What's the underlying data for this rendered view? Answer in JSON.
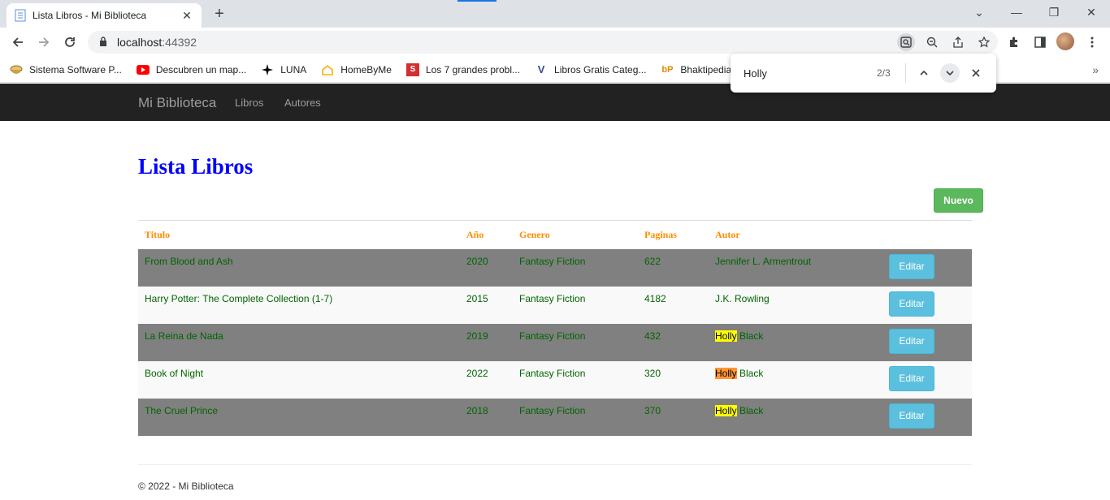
{
  "browser": {
    "tab_title": "Lista Libros - Mi Biblioteca",
    "url_host": "localhost",
    "url_port": ":44392",
    "bookmarks": [
      {
        "label": "Sistema Software P...",
        "icon": "bowl-icon"
      },
      {
        "label": "Descubren un map...",
        "icon": "youtube-icon"
      },
      {
        "label": "LUNA",
        "icon": "sparkle-icon"
      },
      {
        "label": "HomeByMe",
        "icon": "home-icon"
      },
      {
        "label": "Los 7 grandes probl...",
        "icon": "s-icon"
      },
      {
        "label": "Libros Gratis Categ...",
        "icon": "v-icon"
      },
      {
        "label": "Bhaktipedia - Es",
        "icon": "bp-icon"
      }
    ],
    "find": {
      "query": "Holly",
      "count": "2/3"
    }
  },
  "navbar": {
    "brand": "Mi Biblioteca",
    "links": [
      "Libros",
      "Autores"
    ]
  },
  "main": {
    "title": "Lista Libros",
    "new_button": "Nuevo",
    "columns": [
      "Titulo",
      "Año",
      "Genero",
      "Paginas",
      "Autor"
    ],
    "rows": [
      {
        "titulo": "From Blood and Ash",
        "anio": "2020",
        "genero": "Fantasy Fiction",
        "paginas": "622",
        "autor_pre": "",
        "autor_hl": "",
        "autor": "Jennifer L. Armentrout",
        "edit": "Editar"
      },
      {
        "titulo": "Harry Potter: The Complete Collection (1-7)",
        "anio": "2015",
        "genero": "Fantasy Fiction",
        "paginas": "4182",
        "autor_pre": "",
        "autor_hl": "",
        "autor": "J.K. Rowling",
        "edit": "Editar"
      },
      {
        "titulo": "La Reina de Nada",
        "anio": "2019",
        "genero": "Fantasy Fiction",
        "paginas": "432",
        "autor_hl": "Holly",
        "autor": " Black",
        "edit": "Editar"
      },
      {
        "titulo": "Book of Night",
        "anio": "2022",
        "genero": "Fantasy Fiction",
        "paginas": "320",
        "autor_hl": "Holly",
        "autor": " Black",
        "edit": "Editar"
      },
      {
        "titulo": "The Cruel Prince",
        "anio": "2018",
        "genero": "Fantasy Fiction",
        "paginas": "370",
        "autor_hl": "Holly",
        "autor": " Black",
        "edit": "Editar"
      }
    ]
  },
  "footer": {
    "text": "© 2022 - Mi Biblioteca"
  },
  "colors": {
    "title": "#0000ff",
    "header_text": "#ff8c00",
    "cell_text": "#006400",
    "odd_row": "#808080",
    "nuevo": "#5cb85c",
    "editar": "#5bc0de",
    "navbar": "#222222"
  }
}
